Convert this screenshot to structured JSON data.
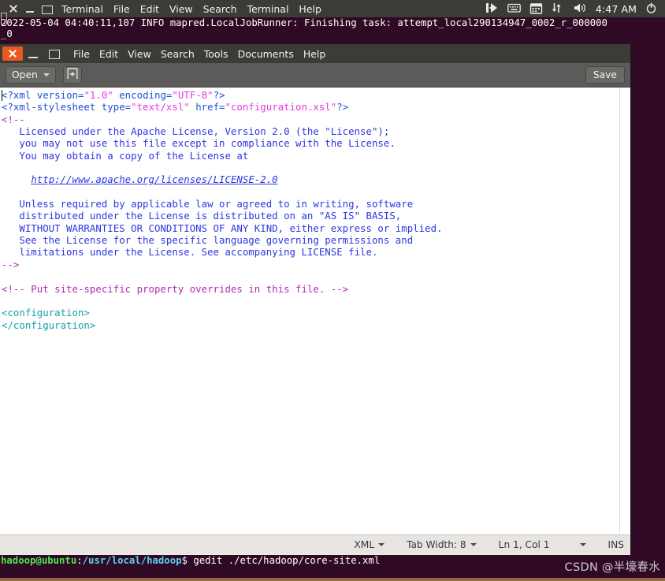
{
  "panel": {
    "window_controls": [
      "close-icon",
      "minimize-icon",
      "maximize-icon"
    ],
    "menus": [
      "Terminal",
      "File",
      "Edit",
      "View",
      "Search",
      "Terminal",
      "Help"
    ],
    "indicators": [
      "messaging-icon",
      "keyboard-icon",
      "calendar-icon",
      "network-icon",
      "volume-icon",
      "power-icon"
    ],
    "clock": "4:47 AM"
  },
  "terminal": {
    "log_line": "2022-05-04 04:40:11,107 INFO mapred.LocalJobRunner: Finishing task: attempt_local290134947_0002_r_000000\n_0",
    "prompt": {
      "user_host": "hadoop@ubuntu",
      "colon": ":",
      "path": "/usr/local/hadoop",
      "dollar": "$ ",
      "command": "gedit ./etc/hadoop/core-site.xml"
    }
  },
  "gedit": {
    "window_controls": [
      "close-icon",
      "minimize-icon",
      "maximize-icon"
    ],
    "menus": [
      "File",
      "Edit",
      "View",
      "Search",
      "Tools",
      "Documents",
      "Help"
    ],
    "toolbar": {
      "open_label": "Open",
      "new_document_icon": "new-document-icon",
      "save_label": "Save"
    },
    "statusbar": {
      "language": "XML",
      "tab_width": "Tab Width: 8",
      "cursor_position": "Ln 1, Col 1",
      "insert_mode": "INS"
    },
    "document": {
      "lines": [
        {
          "type": "mixed",
          "parts": [
            {
              "t": "<?xml ",
              "c": "c-tag"
            },
            {
              "t": "version=",
              "c": "c-attr"
            },
            {
              "t": "\"1.0\"",
              "c": "c-val"
            },
            {
              "t": " encoding=",
              "c": "c-attr"
            },
            {
              "t": "\"UTF-8\"",
              "c": "c-val"
            },
            {
              "t": "?>",
              "c": "c-tag"
            }
          ]
        },
        {
          "type": "mixed",
          "parts": [
            {
              "t": "<?xml-stylesheet ",
              "c": "c-tag"
            },
            {
              "t": "type=",
              "c": "c-attr"
            },
            {
              "t": "\"text/xsl\"",
              "c": "c-val"
            },
            {
              "t": " href=",
              "c": "c-attr"
            },
            {
              "t": "\"configuration.xsl\"",
              "c": "c-val"
            },
            {
              "t": "?>",
              "c": "c-tag"
            }
          ]
        },
        {
          "type": "mixed",
          "parts": [
            {
              "t": "<!--",
              "c": "c-cm-mark"
            }
          ]
        },
        {
          "type": "mixed",
          "parts": [
            {
              "t": "   Licensed under the Apache License, Version 2.0 (the \"License\");",
              "c": "c-comment"
            }
          ]
        },
        {
          "type": "mixed",
          "parts": [
            {
              "t": "   you may not use this file except in compliance with the License.",
              "c": "c-comment"
            }
          ]
        },
        {
          "type": "mixed",
          "parts": [
            {
              "t": "   You may obtain a copy of the License at",
              "c": "c-comment"
            }
          ]
        },
        {
          "type": "mixed",
          "parts": [
            {
              "t": "",
              "c": "c-comment"
            }
          ]
        },
        {
          "type": "mixed",
          "parts": [
            {
              "t": "     ",
              "c": "c-comment"
            },
            {
              "t": "http://www.apache.org/licenses/LICENSE-2.0",
              "c": "c-link"
            }
          ]
        },
        {
          "type": "mixed",
          "parts": [
            {
              "t": "",
              "c": "c-comment"
            }
          ]
        },
        {
          "type": "mixed",
          "parts": [
            {
              "t": "   Unless required by applicable law or agreed to in writing, software",
              "c": "c-comment"
            }
          ]
        },
        {
          "type": "mixed",
          "parts": [
            {
              "t": "   distributed under the License is distributed on an \"AS IS\" BASIS,",
              "c": "c-comment"
            }
          ]
        },
        {
          "type": "mixed",
          "parts": [
            {
              "t": "   WITHOUT WARRANTIES OR CONDITIONS OF ANY KIND, either express or implied.",
              "c": "c-comment"
            }
          ]
        },
        {
          "type": "mixed",
          "parts": [
            {
              "t": "   See the License for the specific language governing permissions and",
              "c": "c-comment"
            }
          ]
        },
        {
          "type": "mixed",
          "parts": [
            {
              "t": "   limitations under the License. See accompanying LICENSE file.",
              "c": "c-comment"
            }
          ]
        },
        {
          "type": "mixed",
          "parts": [
            {
              "t": "-->",
              "c": "c-cm-mark"
            }
          ]
        },
        {
          "type": "mixed",
          "parts": [
            {
              "t": "",
              "c": "c-comment"
            }
          ]
        },
        {
          "type": "mixed",
          "parts": [
            {
              "t": "<!-- Put site-specific property overrides in this file. -->",
              "c": "c-cm-mark"
            }
          ]
        },
        {
          "type": "mixed",
          "parts": [
            {
              "t": "",
              "c": "c-comment"
            }
          ]
        },
        {
          "type": "mixed",
          "parts": [
            {
              "t": "<configuration>",
              "c": "c-elem"
            }
          ]
        },
        {
          "type": "mixed",
          "parts": [
            {
              "t": "</configuration>",
              "c": "c-elem"
            }
          ]
        }
      ]
    }
  },
  "watermark": "CSDN @半壕春水",
  "colors": {
    "terminal_bg": "#300a24",
    "panel_bg": "#3c3b37",
    "close_orange": "#e9581e",
    "toolbar_bg": "#5c5b59",
    "statusbar_bg": "#e7e4e2",
    "xml_value": "#e838e0",
    "xml_tag": "#1f4fd8",
    "xml_comment": "#2b37e0",
    "xml_element": "#16a0a8",
    "prompt_user": "#4ee44e",
    "prompt_path": "#5ad2f4"
  }
}
